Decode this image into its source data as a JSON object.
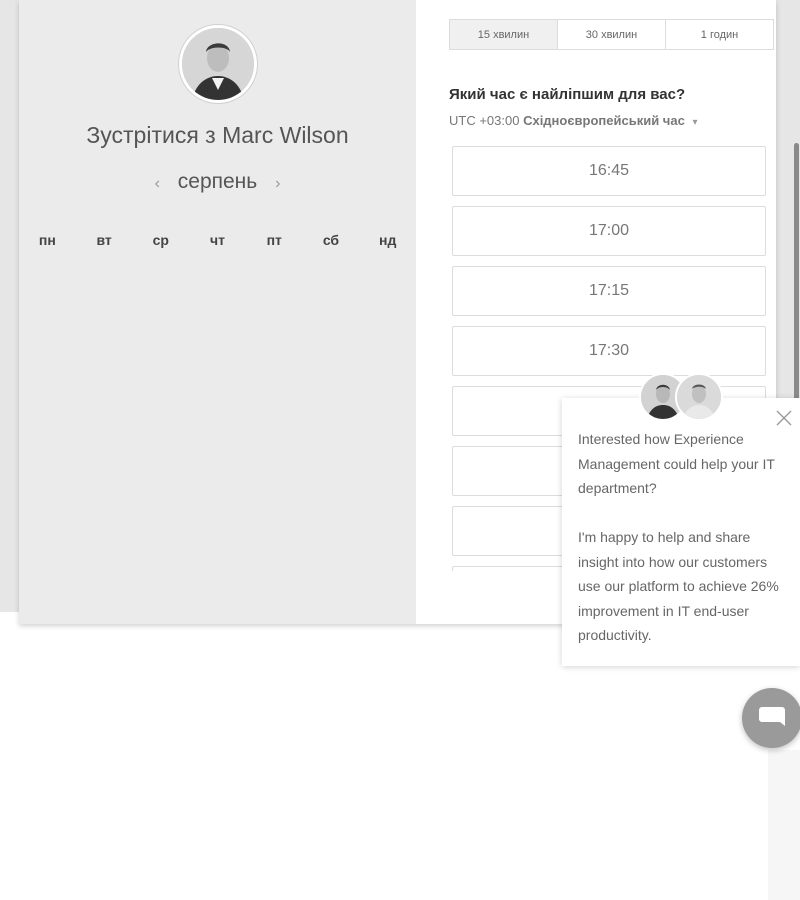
{
  "host": {
    "avatar_icon": "person-photo",
    "meet_prefix": "Зустрітися з ",
    "host_name": "Marc Wilson"
  },
  "calendar": {
    "month": "серпень",
    "prev_icon": "‹",
    "next_icon": "›",
    "weekdays": [
      "пн",
      "вт",
      "ср",
      "чт",
      "пт",
      "сб",
      "нд"
    ]
  },
  "duration": {
    "options": [
      "15 хвилин",
      "30 хвилин",
      "1 годин"
    ],
    "selected": "15 хвилин"
  },
  "time_picker": {
    "question": "Який час є найліпшим для вас?",
    "timezone_offset": "UTC +03:00",
    "timezone_name": "Східноєвропейський час",
    "caret_icon": "▾",
    "slots": [
      "16:45",
      "17:00",
      "17:15",
      "17:30",
      "",
      "",
      "",
      ""
    ]
  },
  "chat": {
    "message": "Interested how Experience Management could help your IT department?\n\nI'm happy to help and share insight into how our customers use our platform to achieve 26% improvement in IT end-user productivity.",
    "close_icon": "close-icon",
    "launcher_icon": "chat-bubble-icon"
  },
  "colors": {
    "left_panel": "#ebebeb",
    "page_gray": "#e6e6e6",
    "launcher": "#9a9a9a",
    "scrollbar": "#8a8a8a"
  }
}
